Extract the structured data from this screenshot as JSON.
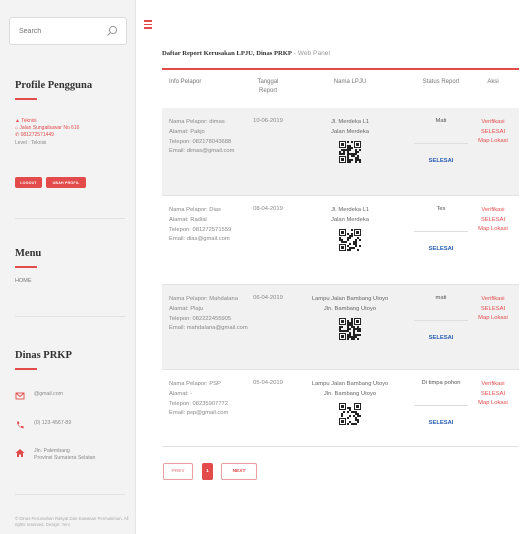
{
  "search": {
    "placeholder": "Search"
  },
  "profile": {
    "heading": "Profile Pengguna",
    "name": "Teknisi",
    "address": "Jalan Sungaibawar No 616",
    "phone": "081272571449",
    "level": "Level : Teknisi",
    "btn_logout": "LOGOUT",
    "btn_ubah": "UBAH PROFIL"
  },
  "menu": {
    "heading": "Menu",
    "home": "HOME"
  },
  "dinas": {
    "heading": "Dinas PRKP",
    "email": "@gmail.com",
    "phone": "(0) 123-4567-89",
    "address_1": "Jln. Palembang",
    "address_2": "Provinsi Sumatera Selatan"
  },
  "footer": "© Dinas Perumahan Rakyat Dan Kawasan Permukiman. All rights reserved. Design: Yeni",
  "page": {
    "title_bold": "Daftar Report Kerusakan LPJU, Dinas PRKP",
    "title_sub": " - Web Panel"
  },
  "table": {
    "headers": {
      "info": "Info Pelapor",
      "tanggal_1": "Tanggal",
      "tanggal_2": "Report",
      "lpju": "Nama LPJU",
      "status": "Status Report",
      "aksi": "Aksi"
    },
    "labels": {
      "nama": "Nama Pelapor: ",
      "alamat": "Alamat: ",
      "telepon": "Telepon: ",
      "email": "Email: "
    },
    "rows": [
      {
        "nama": "dimas",
        "alamat": "Pakjo",
        "telepon": "082178043688",
        "email": "dimas@gmail.com",
        "tanggal": "10-06-2019",
        "lpju_1": "Jl. Merdeka L1",
        "lpju_2": "Jalan Merdeka",
        "status": "Mati",
        "selesai": "SELESAI",
        "aksi_1": "Verifikasi",
        "aksi_2": "SELESAI",
        "aksi_3": "Map Lokasi"
      },
      {
        "nama": "Dias",
        "alamat": "Radial",
        "telepon": "081272571559",
        "email": "dias@gmail.com",
        "tanggal": "08-04-2019",
        "lpju_1": "Jl. Merdeka L1",
        "lpju_2": "Jalan Merdeka",
        "status": "Tes",
        "selesai": "SELESAI",
        "aksi_1": "Verifikasi",
        "aksi_2": "SELESAI",
        "aksi_3": "Map Lokasi"
      },
      {
        "nama": "Mahdalana",
        "alamat": "Plaju",
        "telepon": "082222455905",
        "email": "mahdalana@gmail.com",
        "tanggal": "06-04-2019",
        "lpju_1": "Lampu Jalan Bambang Utoyo",
        "lpju_2": "Jln. Bambang Utoyo",
        "status": "mati",
        "selesai": "SELESAI",
        "aksi_1": "Verifikasi",
        "aksi_2": "SELESAI",
        "aksi_3": "Map Lokasi"
      },
      {
        "nama": "PSP",
        "alamat": "-",
        "telepon": "08235907772",
        "email": "psp@gmail.com",
        "tanggal": "05-04-2019",
        "lpju_1": "Lampu Jalan Bambang Utoyo",
        "lpju_2": "Jln. Bambang Utoyo",
        "status": "Di timpa pohon",
        "selesai": "SELESAI",
        "aksi_1": "Verifikasi",
        "aksi_2": "SELESAI",
        "aksi_3": "Map Lokasi"
      }
    ]
  },
  "pagination": {
    "prev": "PREV",
    "page": "1",
    "next": "NEXT"
  },
  "colors": {
    "accent": "#e34b4b",
    "link_blue": "#2a5fb4",
    "sidebar_bg": "#f3f3f3"
  },
  "icons": [
    "search-icon",
    "hamburger-icon",
    "envelope-icon",
    "phone-icon",
    "home-icon",
    "qr-code-icon"
  ]
}
